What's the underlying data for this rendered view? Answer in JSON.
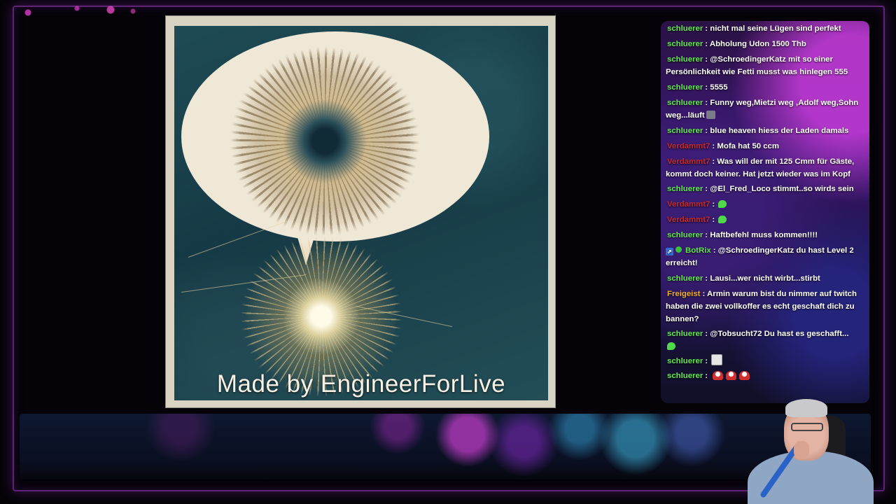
{
  "overlay": {
    "artwork_caption": "Made by EngineerForLive"
  },
  "chat": {
    "messages": [
      {
        "user": "schluerer",
        "user_color": "green",
        "text": "nicht mal seine Lügen sind perfekt"
      },
      {
        "user": "schluerer",
        "user_color": "green",
        "text": "Abholung Udon 1500 Thb"
      },
      {
        "user": "schluerer",
        "user_color": "green",
        "text": "@SchroedingerKatz mit so einer Persönlichkeit wie Fetti musst was hinlegen 555"
      },
      {
        "user": "schluerer",
        "user_color": "green",
        "text": "5555"
      },
      {
        "user": "schluerer",
        "user_color": "green",
        "text": "Funny weg,Mietzi weg ,Adolf weg,Sohn weg...läuft",
        "emote": "box"
      },
      {
        "user": "schluerer",
        "user_color": "green",
        "text": "blue heaven hiess der Laden damals"
      },
      {
        "user": "Verdammt7",
        "user_color": "red",
        "text": "Mofa hat 50 ccm"
      },
      {
        "user": "Verdammt7",
        "user_color": "red",
        "text": "Was will der mit 125 Cmm für Gäste, kommt doch keiner. Hat jetzt wieder was im Kopf"
      },
      {
        "user": "schluerer",
        "user_color": "green",
        "text": "@El_Fred_Loco stimmt..so wirds sein"
      },
      {
        "user": "Verdammt7",
        "user_color": "red",
        "text": "",
        "emote": "green"
      },
      {
        "user": "Verdammt7",
        "user_color": "red",
        "text": "",
        "emote": "green"
      },
      {
        "user": "schluerer",
        "user_color": "green",
        "text": "Haftbefehl muss kommen!!!!"
      },
      {
        "user": "BotRix",
        "user_color": "green",
        "text": "@SchroedingerKatz du hast Level 2 erreicht!",
        "bot": true
      },
      {
        "user": "schluerer",
        "user_color": "green",
        "text": "Lausi...wer nicht wirbt...stirbt"
      },
      {
        "user": "Freigeist",
        "user_color": "orange",
        "text": "Armin warum bist du nimmer auf twitch haben die zwei vollkoffer es echt geschaft dich zu bannen?"
      },
      {
        "user": "schluerer",
        "user_color": "green",
        "text": "@Tobsucht72 Du hast es geschafft...",
        "emote_newline": "green"
      },
      {
        "user": "schluerer",
        "user_color": "green",
        "text": "",
        "emote": "ghost"
      },
      {
        "user": "schluerer",
        "user_color": "green",
        "text": "",
        "emote": "red3"
      }
    ]
  },
  "colors": {
    "frame_accent": "#aa3cd2",
    "username_green": "#5fe84e",
    "username_red": "#c72a2a",
    "username_orange": "#f0b030"
  }
}
